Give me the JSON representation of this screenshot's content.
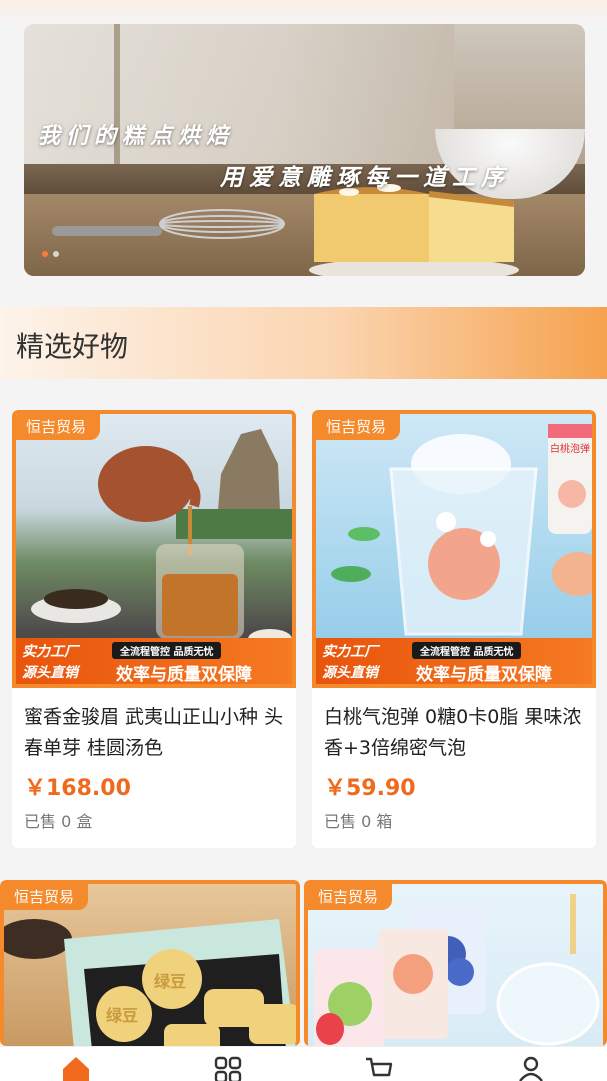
{
  "banner": {
    "line1": "我们的糕点烘焙",
    "line2": "用爱意雕琢每一道工序",
    "slide_count": 2,
    "active_slide": 1
  },
  "section": {
    "title": "精选好物"
  },
  "products": [
    {
      "brand": "恒吉贸易",
      "badge_top": "实力工厂",
      "badge_bottom": "源头直销",
      "badge_tag": "全流程管控 品质无忧",
      "badge_slogan": "效率与质量双保障",
      "name": "蜜香金骏眉 武夷山正山小种 头春单芽 桂圆汤色",
      "price": "￥168.00",
      "sold": "已售 0 盒"
    },
    {
      "brand": "恒吉贸易",
      "badge_top": "实力工厂",
      "badge_bottom": "源头直销",
      "badge_tag": "全流程管控 品质无忧",
      "badge_slogan": "效率与质量双保障",
      "name": "白桃气泡弹 0糖0卡0脂 果味浓香+3倍绵密气泡",
      "price": "￥59.90",
      "sold": "已售 0 箱",
      "can_label": "白桃泡弹"
    },
    {
      "brand": "恒吉贸易",
      "pastry_stamp": "绿豆"
    },
    {
      "brand": "恒吉贸易"
    }
  ],
  "nav": {
    "items": [
      "home-icon",
      "category-icon",
      "cart-icon",
      "profile-icon"
    ],
    "active": "home-icon",
    "accent": "#f06a1e"
  },
  "colors": {
    "accent": "#f48a2c",
    "price": "#f06a1e"
  }
}
